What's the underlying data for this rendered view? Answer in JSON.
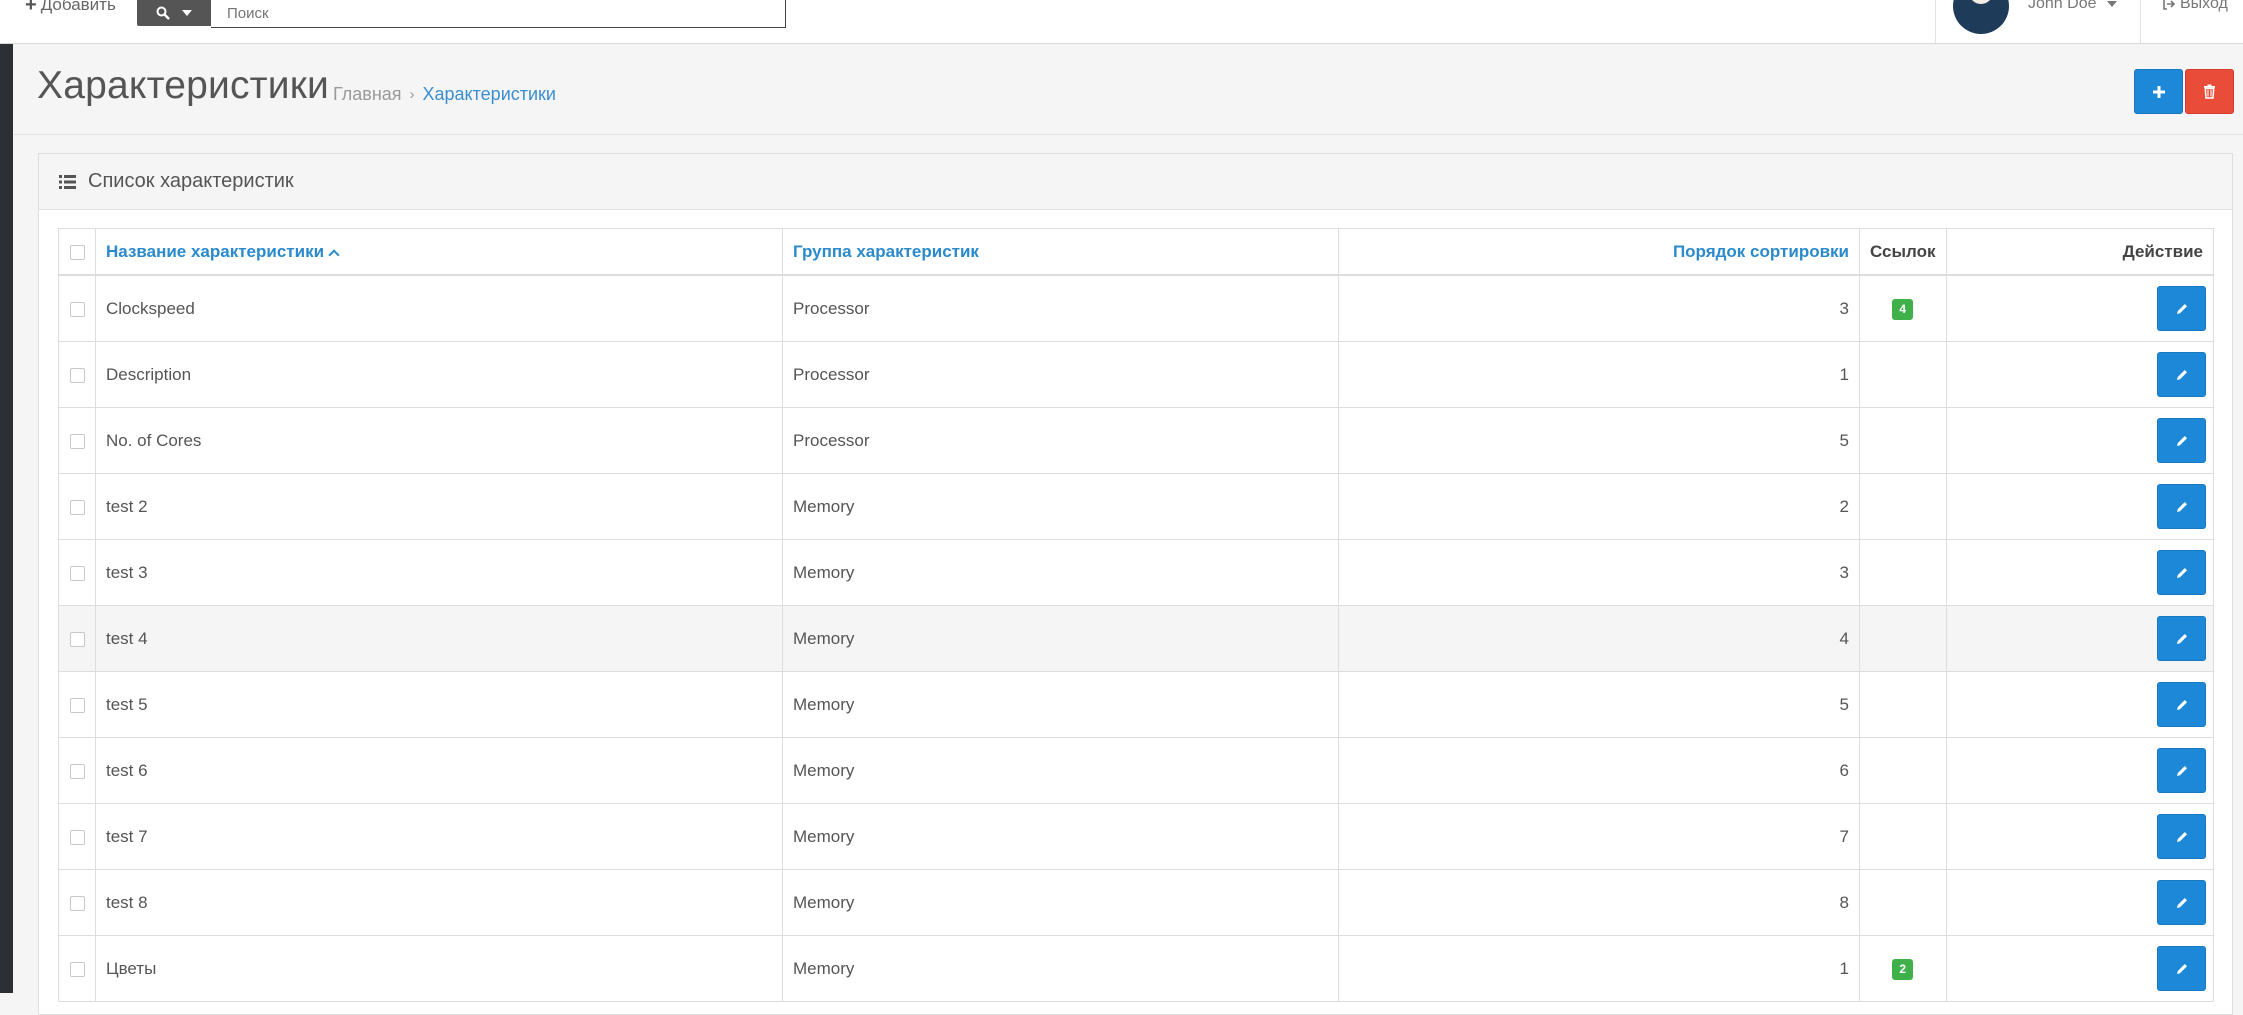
{
  "topbar": {
    "add_label": "Добавить",
    "search_placeholder": "Поиск",
    "user_name": "John Doe",
    "logout_label": "Выход"
  },
  "page": {
    "title": "Характеристики",
    "breadcrumb": [
      "Главная",
      "Характеристики"
    ]
  },
  "panel": {
    "title": "Список характеристик"
  },
  "table": {
    "headers": {
      "name": "Название характеристики",
      "group": "Группа характеристик",
      "sort": "Порядок сортировки",
      "links": "Ссылок",
      "action": "Действие"
    },
    "rows": [
      {
        "name": "Clockspeed",
        "group": "Processor",
        "sort": "3",
        "links": "4"
      },
      {
        "name": "Description",
        "group": "Processor",
        "sort": "1",
        "links": ""
      },
      {
        "name": "No. of Cores",
        "group": "Processor",
        "sort": "5",
        "links": ""
      },
      {
        "name": "test 2",
        "group": "Memory",
        "sort": "2",
        "links": ""
      },
      {
        "name": "test 3",
        "group": "Memory",
        "sort": "3",
        "links": ""
      },
      {
        "name": "test 4",
        "group": "Memory",
        "sort": "4",
        "links": ""
      },
      {
        "name": "test 5",
        "group": "Memory",
        "sort": "5",
        "links": ""
      },
      {
        "name": "test 6",
        "group": "Memory",
        "sort": "6",
        "links": ""
      },
      {
        "name": "test 7",
        "group": "Memory",
        "sort": "7",
        "links": ""
      },
      {
        "name": "test 8",
        "group": "Memory",
        "sort": "8",
        "links": ""
      },
      {
        "name": "Цветы",
        "group": "Memory",
        "sort": "1",
        "links": "2"
      }
    ]
  },
  "icons": {
    "add": "plus-icon",
    "search": "search-icon",
    "logout": "sign-out-icon",
    "delete": "trash-icon",
    "list": "list-icon",
    "edit": "pencil-icon"
  },
  "colors": {
    "primary": "#1e88d8",
    "danger": "#e94d3a",
    "success": "#3fb04a",
    "link": "#2a8acc"
  }
}
